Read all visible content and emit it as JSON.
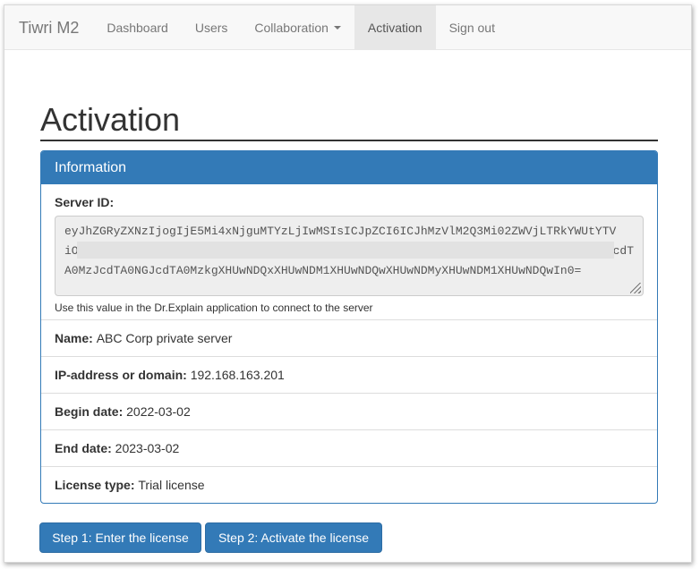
{
  "navbar": {
    "brand": "Tiwri M2",
    "items": [
      {
        "label": "Dashboard"
      },
      {
        "label": "Users"
      },
      {
        "label": "Collaboration"
      },
      {
        "label": "Activation"
      },
      {
        "label": "Sign out"
      }
    ]
  },
  "page": {
    "title": "Activation"
  },
  "panel": {
    "heading": "Information",
    "server_id": {
      "label": "Server ID:",
      "line1": "eyJhZGRyZXNzIjogIjE5Mi4xNjguMTYzLjIwMSIsICJpZCI6ICJhMzVlM2Q3Mi02ZWVjLTRkYWUtYTV",
      "line2_start": "iO",
      "line2_end": "cdT",
      "line3": "A0MzJcdTA0NGJcdTA0MzkgXHUwNDQxXHUwNDM1XHUwNDQwXHUwNDMyXHUwNDM1XHUwNDQwIn0=",
      "help": "Use this value in the Dr.Explain application to connect to the server"
    },
    "name": {
      "label": "Name:",
      "value": "ABC Corp private server"
    },
    "ip": {
      "label": "IP-address or domain:",
      "value": "192.168.163.201"
    },
    "begin_date": {
      "label": "Begin date:",
      "value": "2022-03-02"
    },
    "end_date": {
      "label": "End date:",
      "value": "2023-03-02"
    },
    "license_type": {
      "label": "License type:",
      "value": "Trial license"
    }
  },
  "buttons": {
    "step1": "Step 1: Enter the license",
    "step2": "Step 2: Activate the license"
  }
}
